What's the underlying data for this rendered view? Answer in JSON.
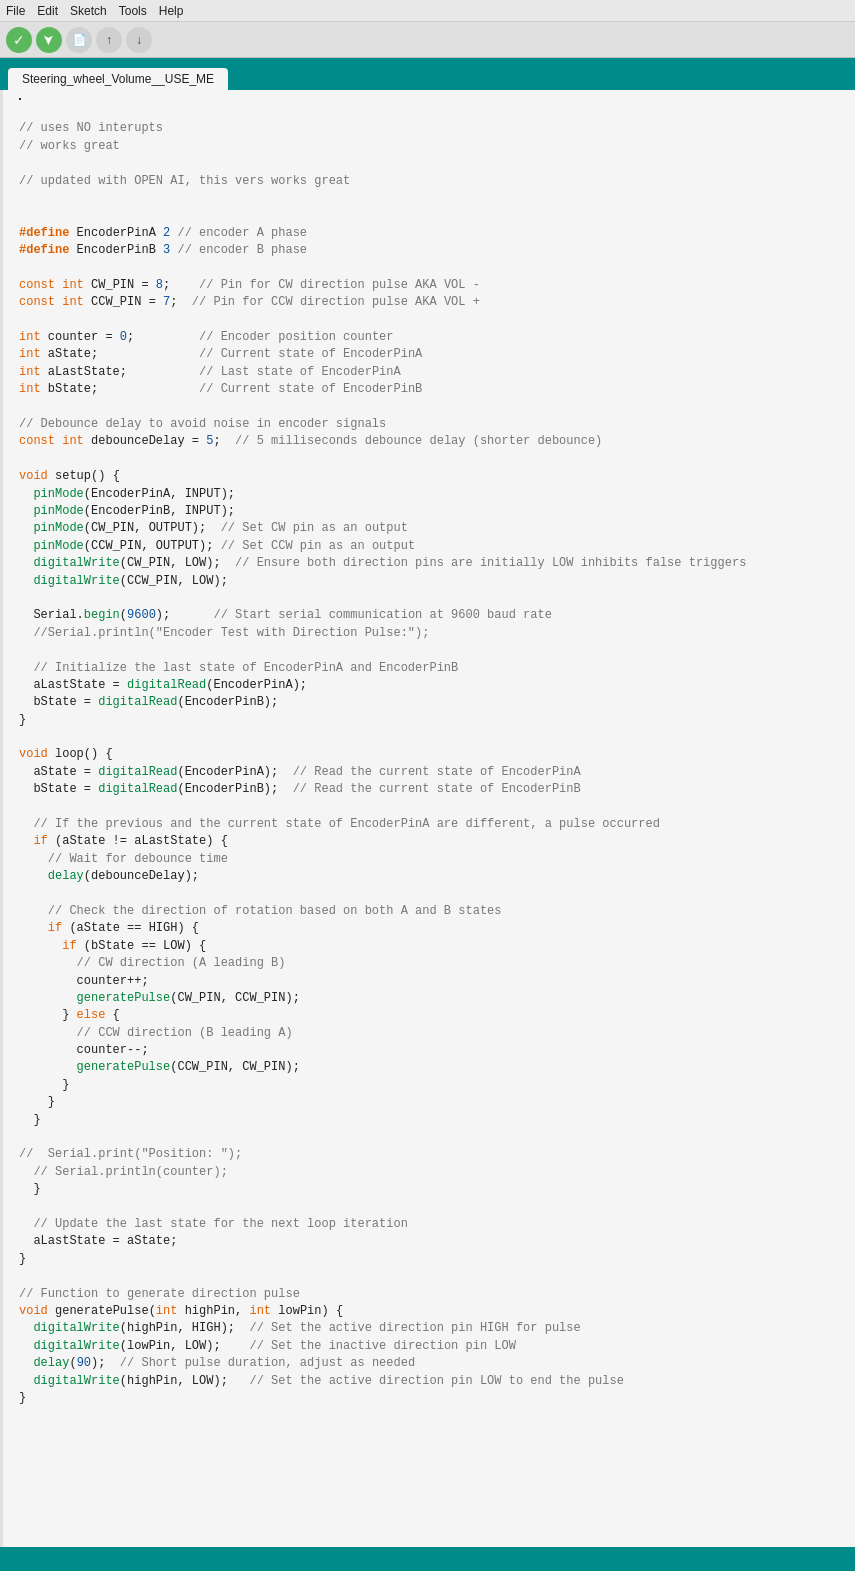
{
  "menu": {
    "items": [
      "File",
      "Edit",
      "Sketch",
      "Tools",
      "Help"
    ]
  },
  "toolbar": {
    "buttons": [
      {
        "label": "✓",
        "class": "btn-check",
        "name": "verify-button"
      },
      {
        "label": "→",
        "class": "btn-upload",
        "name": "upload-button"
      },
      {
        "label": "□",
        "class": "btn-new",
        "name": "new-button"
      },
      {
        "label": "↑",
        "class": "btn-open",
        "name": "open-button"
      },
      {
        "label": "↓",
        "class": "btn-save",
        "name": "save-button"
      }
    ]
  },
  "tab": {
    "label": "Steering_wheel_Volume__USE_ME"
  },
  "code": {
    "lines": [
      "",
      "// uses NO interupts",
      "// works great",
      "",
      "// updated with OPEN AI, this vers works great",
      "",
      "",
      "#define EncoderPinA 2 // encoder A phase",
      "#define EncoderPinB 3 // encoder B phase",
      "",
      "const int CW_PIN = 8;    // Pin for CW direction pulse AKA VOL -",
      "const int CCW_PIN = 7;  // Pin for CCW direction pulse AKA VOL +",
      "",
      "int counter = 0;         // Encoder position counter",
      "int aState;              // Current state of EncoderPinA",
      "int aLastState;          // Last state of EncoderPinA",
      "int bState;              // Current state of EncoderPinB",
      "",
      "// Debounce delay to avoid noise in encoder signals",
      "const int debounceDelay = 5;  // 5 milliseconds debounce delay (shorter debounce)",
      "",
      "void setup() {",
      "  pinMode(EncoderPinA, INPUT);",
      "  pinMode(EncoderPinB, INPUT);",
      "  pinMode(CW_PIN, OUTPUT);  // Set CW pin as an output",
      "  pinMode(CCW_PIN, OUTPUT); // Set CCW pin as an output",
      "  digitalWrite(CW_PIN, LOW);  // Ensure both direction pins are initially LOW inhibits false triggers",
      "  digitalWrite(CCW_PIN, LOW);",
      "",
      "  Serial.begin(9600);      // Start serial communication at 9600 baud rate",
      "  //Serial.println(\"Encoder Test with Direction Pulse:\");",
      "",
      "  // Initialize the last state of EncoderPinA and EncoderPinB",
      "  aLastState = digitalRead(EncoderPinA);",
      "  bState = digitalRead(EncoderPinB);",
      "}",
      "",
      "void loop() {",
      "  aState = digitalRead(EncoderPinA);  // Read the current state of EncoderPinA",
      "  bState = digitalRead(EncoderPinB);  // Read the current state of EncoderPinB",
      "",
      "  // If the previous and the current state of EncoderPinA are different, a pulse occurred",
      "  if (aState != aLastState) {",
      "    // Wait for debounce time",
      "    delay(debounceDelay);",
      "",
      "    // Check the direction of rotation based on both A and B states",
      "    if (aState == HIGH) {",
      "      if (bState == LOW) {",
      "        // CW direction (A leading B)",
      "        counter++;",
      "        generatePulse(CW_PIN, CCW_PIN);",
      "      } else {",
      "        // CCW direction (B leading A)",
      "        counter--;",
      "        generatePulse(CCW_PIN, CW_PIN);",
      "      }",
      "    }",
      "  }",
      "",
      "//  Serial.print(\"Position: \");",
      "  // Serial.println(counter);",
      "  }",
      "",
      "  // Update the last state for the next loop iteration",
      "  aLastState = aState;",
      "}",
      "",
      "// Function to generate direction pulse",
      "void generatePulse(int highPin, int lowPin) {",
      "  digitalWrite(highPin, HIGH);  // Set the active direction pin HIGH for pulse",
      "  digitalWrite(lowPin, LOW);    // Set the inactive direction pin LOW",
      "  delay(90);  // Short pulse duration, adjust as needed",
      "  digitalWrite(highPin, LOW);   // Set the active direction pin LOW to end the pulse",
      "}"
    ]
  },
  "status": {
    "text": ""
  }
}
